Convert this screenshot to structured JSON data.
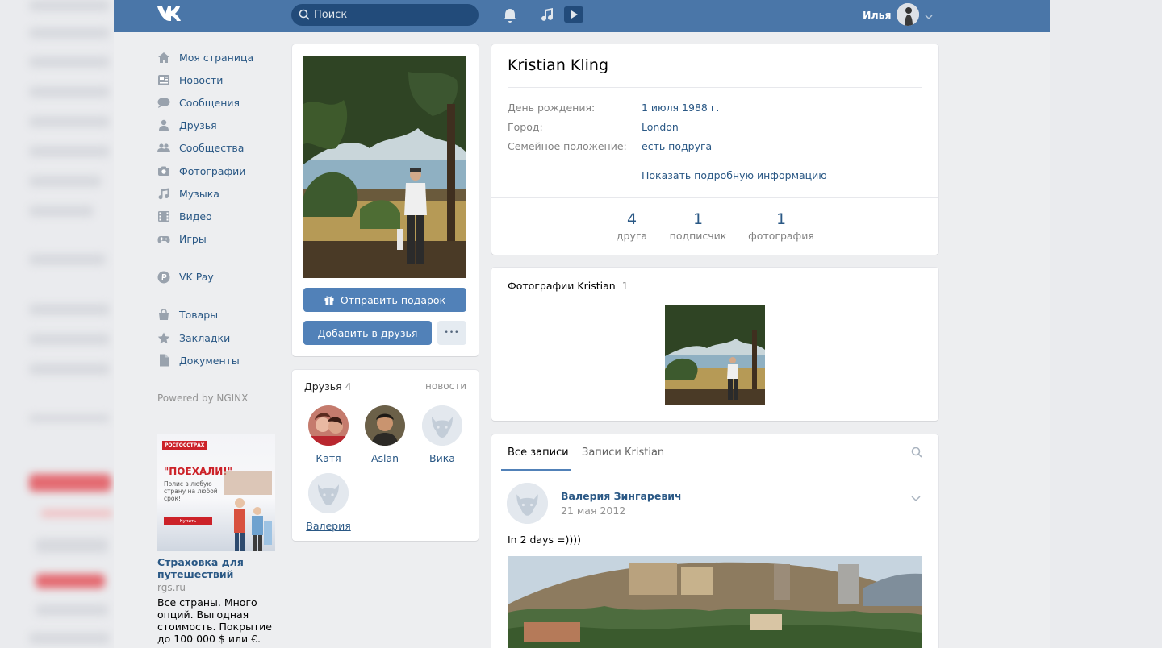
{
  "header": {
    "logo_text": "VK",
    "search_placeholder": "Поиск",
    "user_name": "Илья"
  },
  "sidebar": {
    "items": [
      {
        "label": "Моя страница",
        "icon": "home-icon"
      },
      {
        "label": "Новости",
        "icon": "news-icon"
      },
      {
        "label": "Сообщения",
        "icon": "messages-icon"
      },
      {
        "label": "Друзья",
        "icon": "friend-icon"
      },
      {
        "label": "Сообщества",
        "icon": "groups-icon"
      },
      {
        "label": "Фотографии",
        "icon": "camera-icon"
      },
      {
        "label": "Музыка",
        "icon": "music-icon"
      },
      {
        "label": "Видео",
        "icon": "video-icon"
      },
      {
        "label": "Игры",
        "icon": "gamepad-icon"
      }
    ],
    "pay_item": {
      "label": "VK Pay",
      "icon": "vkpay-icon"
    },
    "extra_items": [
      {
        "label": "Товары",
        "icon": "bag-icon"
      },
      {
        "label": "Закладки",
        "icon": "star-icon"
      },
      {
        "label": "Документы",
        "icon": "document-icon"
      }
    ],
    "powered_by": "Powered by NGINX"
  },
  "ad": {
    "brand": "РОСГОССТРАХ",
    "headline": "\"ПОЕХАЛИ!\"",
    "subtext": "Полис в любую страну на любой срок!",
    "cta": "Купить",
    "title": "Страховка для путешествий",
    "domain": "rgs.ru",
    "text": "Все страны. Много опций. Выгодная стоимость. Покрытие до 100 000 $ или €."
  },
  "profile": {
    "send_gift": "Отправить подарок",
    "add_friend": "Добавить в друзья",
    "more_glyph": "•••",
    "name": "Kristian Kling",
    "info": [
      {
        "label": "День рождения:",
        "value": "1 июля 1988 г."
      },
      {
        "label": "Город:",
        "value": "London"
      },
      {
        "label": "Семейное положение:",
        "value": "есть подруга"
      }
    ],
    "show_more": "Показать подробную информацию",
    "counters": [
      {
        "number": "4",
        "label": "друга"
      },
      {
        "number": "1",
        "label": "подписчик"
      },
      {
        "number": "1",
        "label": "фотография"
      }
    ]
  },
  "friends": {
    "title": "Друзья",
    "count": "4",
    "news_link": "новости",
    "list": [
      {
        "name": "Катя"
      },
      {
        "name": "Aslan"
      },
      {
        "name": "Вика"
      },
      {
        "name": "Валерия"
      }
    ]
  },
  "photos": {
    "title": "Фотографии Kristian",
    "count": "1"
  },
  "wall": {
    "tabs": [
      "Все записи",
      "Записи Kristian"
    ],
    "post": {
      "author": "Валерия Зингаревич",
      "date": "21 мая 2012",
      "text": "In 2 days =))))"
    }
  },
  "colors": {
    "header_bg": "#4a76a8",
    "link": "#2a5885",
    "button_blue": "#5181b8",
    "page_bg": "#edeef0"
  }
}
